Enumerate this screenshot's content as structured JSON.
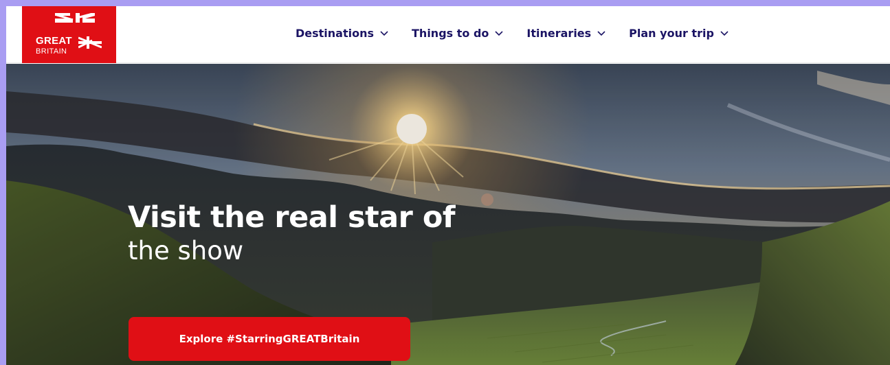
{
  "logo": {
    "line1": "GREAT",
    "line2": "BRITAIN"
  },
  "nav": {
    "items": [
      {
        "label": "Destinations",
        "icon": "chevron-down-icon"
      },
      {
        "label": "Things to do",
        "icon": "chevron-down-icon"
      },
      {
        "label": "Itineraries",
        "icon": "chevron-down-icon"
      },
      {
        "label": "Plan your trip",
        "icon": "chevron-down-icon"
      }
    ]
  },
  "hero": {
    "headline_bold": "Visit the real star of",
    "headline_light": "the show",
    "cta_label": "Explore #StarringGREATBritain"
  },
  "colors": {
    "brand_red": "#e00f15",
    "nav_text": "#1b1464",
    "outer_border": "#a99df2"
  }
}
